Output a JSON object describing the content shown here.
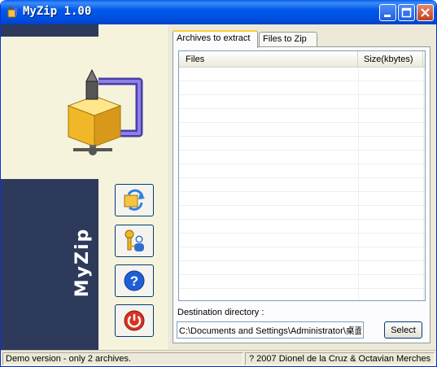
{
  "window": {
    "title": "MyZip 1.00"
  },
  "brand": {
    "vertical_text": "MyZip"
  },
  "tabs": [
    {
      "label": "Archives to extract",
      "active": true
    },
    {
      "label": "Files to Zip",
      "active": false
    }
  ],
  "file_list": {
    "columns": [
      "Files",
      "Size(kbytes)"
    ],
    "rows": []
  },
  "destination": {
    "label": "Destination directory :",
    "value": "C:\\Documents and Settings\\Administrator\\桌面",
    "button_label": "Select"
  },
  "side_buttons": [
    {
      "icon": "refresh-arrows-icon"
    },
    {
      "icon": "keys-user-icon"
    },
    {
      "icon": "help-icon"
    },
    {
      "icon": "power-icon"
    }
  ],
  "status": {
    "left": "Demo version - only 2 archives.",
    "right": "? 2007 Dionel de la Cruz & Octavian Merches"
  },
  "colors": {
    "titlebar": "#0058ee",
    "sidebar_navy": "#2e3a5c",
    "sidebar_cream": "#f6f3dc",
    "help_blue": "#1f5fd6",
    "power_red": "#d83222"
  }
}
